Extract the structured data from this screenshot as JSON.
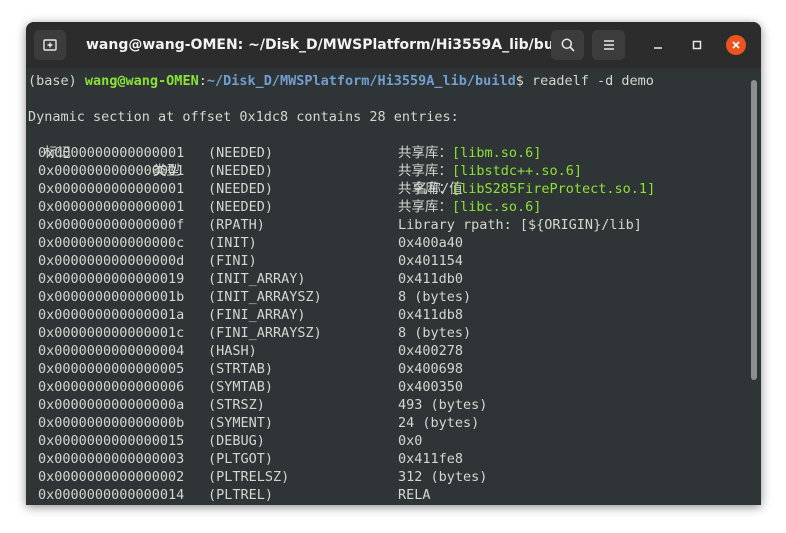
{
  "window": {
    "title": "wang@wang-OMEN: ~/Disk_D/MWSPlatform/Hi3559A_lib/build"
  },
  "prompt": {
    "env": "(base) ",
    "user_host": "wang@wang-OMEN",
    "colon": ":",
    "path": "~/Disk_D/MWSPlatform/Hi3559A_lib/build",
    "dollar": "$ ",
    "command": "readelf -d demo"
  },
  "output": {
    "summary": "Dynamic section at offset 0x1dc8 contains 28 entries:",
    "headers": {
      "tag": "标记",
      "type": "类型",
      "value": "名称/值"
    },
    "rows": [
      {
        "tag": "0x0000000000000001",
        "type": "(NEEDED)",
        "prefix": "共享库：",
        "value": "[libm.so.6]"
      },
      {
        "tag": "0x0000000000000001",
        "type": "(NEEDED)",
        "prefix": "共享库：",
        "value": "[libstdc++.so.6]"
      },
      {
        "tag": "0x0000000000000001",
        "type": "(NEEDED)",
        "prefix": "共享库：",
        "value": "[libS285FireProtect.so.1]"
      },
      {
        "tag": "0x0000000000000001",
        "type": "(NEEDED)",
        "prefix": "共享库：",
        "value": "[libc.so.6]"
      },
      {
        "tag": "0x000000000000000f",
        "type": "(RPATH)",
        "prefix": "",
        "value": "Library rpath: [${ORIGIN}/lib]"
      },
      {
        "tag": "0x000000000000000c",
        "type": "(INIT)",
        "prefix": "",
        "value": "0x400a40"
      },
      {
        "tag": "0x000000000000000d",
        "type": "(FINI)",
        "prefix": "",
        "value": "0x401154"
      },
      {
        "tag": "0x0000000000000019",
        "type": "(INIT_ARRAY)",
        "prefix": "",
        "value": "0x411db0"
      },
      {
        "tag": "0x000000000000001b",
        "type": "(INIT_ARRAYSZ)",
        "prefix": "",
        "value": "8 (bytes)"
      },
      {
        "tag": "0x000000000000001a",
        "type": "(FINI_ARRAY)",
        "prefix": "",
        "value": "0x411db8"
      },
      {
        "tag": "0x000000000000001c",
        "type": "(FINI_ARRAYSZ)",
        "prefix": "",
        "value": "8 (bytes)"
      },
      {
        "tag": "0x0000000000000004",
        "type": "(HASH)",
        "prefix": "",
        "value": "0x400278"
      },
      {
        "tag": "0x0000000000000005",
        "type": "(STRTAB)",
        "prefix": "",
        "value": "0x400698"
      },
      {
        "tag": "0x0000000000000006",
        "type": "(SYMTAB)",
        "prefix": "",
        "value": "0x400350"
      },
      {
        "tag": "0x000000000000000a",
        "type": "(STRSZ)",
        "prefix": "",
        "value": "493 (bytes)"
      },
      {
        "tag": "0x000000000000000b",
        "type": "(SYMENT)",
        "prefix": "",
        "value": "24 (bytes)"
      },
      {
        "tag": "0x0000000000000015",
        "type": "(DEBUG)",
        "prefix": "",
        "value": "0x0"
      },
      {
        "tag": "0x0000000000000003",
        "type": "(PLTGOT)",
        "prefix": "",
        "value": "0x411fe8"
      },
      {
        "tag": "0x0000000000000002",
        "type": "(PLTRELSZ)",
        "prefix": "",
        "value": "312 (bytes)"
      },
      {
        "tag": "0x0000000000000014",
        "type": "(PLTREL)",
        "prefix": "",
        "value": "RELA"
      }
    ]
  },
  "icons": {
    "new_tab": "new-tab-icon",
    "search": "search-icon",
    "menu": "hamburger-menu-icon",
    "minimize": "minimize-icon",
    "maximize": "maximize-icon",
    "close": "close-icon"
  },
  "colors": {
    "terminal_bg": "#2f3437",
    "titlebar_bg": "#2c2c2c",
    "prompt_user": "#8ae234",
    "prompt_path": "#729fcf",
    "text": "#d3d7cf",
    "close_button": "#e9541f"
  }
}
